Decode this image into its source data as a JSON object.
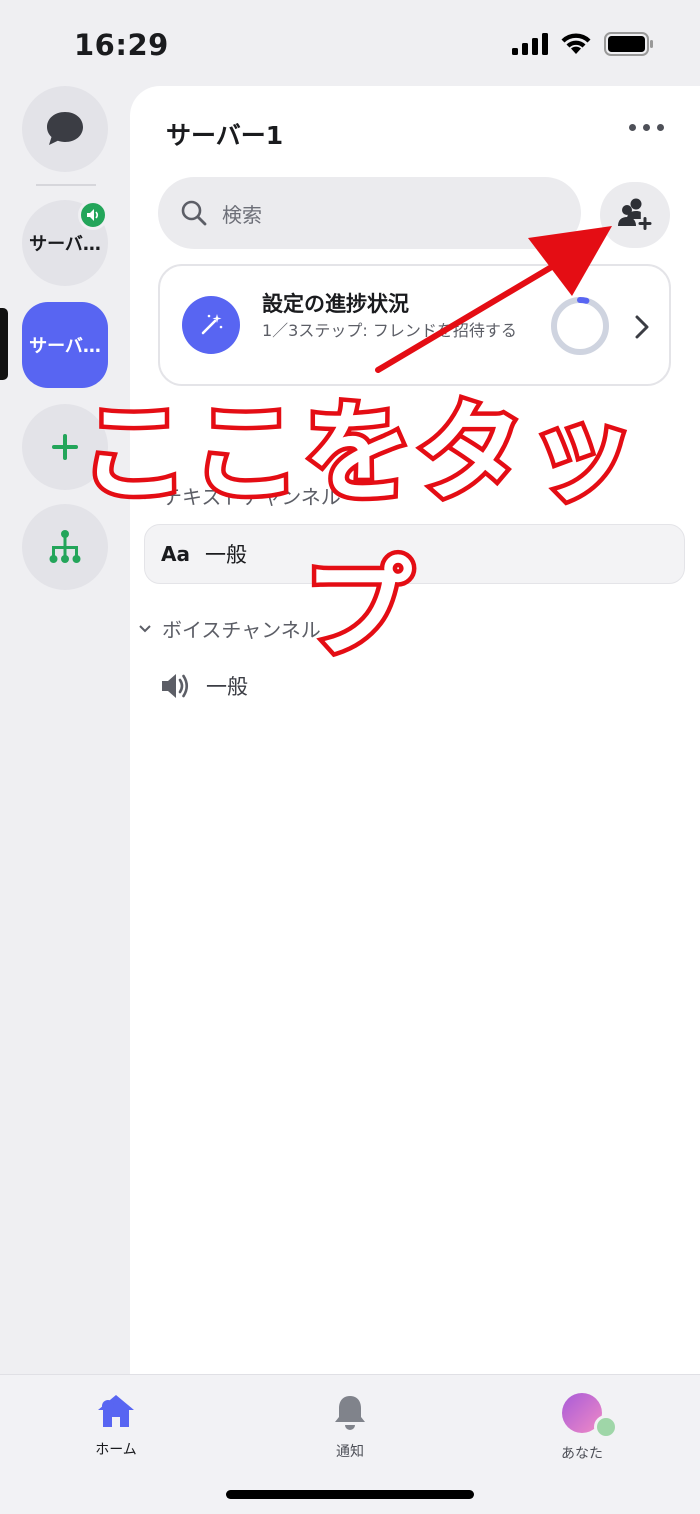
{
  "status_bar": {
    "time": "16:29",
    "icons": [
      "signal-icon",
      "wifi-icon",
      "battery-icon"
    ]
  },
  "rail": {
    "items": [
      {
        "icon": "chat-bubble-icon",
        "label": ""
      },
      {
        "label": "サーバ…",
        "badge_icon": "speaker-icon"
      },
      {
        "label": "サーバ…",
        "active": true
      },
      {
        "icon": "add-server-icon",
        "label": ""
      },
      {
        "icon": "hub-icon",
        "label": ""
      }
    ]
  },
  "header": {
    "server_name": "サーバー1",
    "more_icon": "ellipsis-icon"
  },
  "search": {
    "placeholder": "検索",
    "icon": "search-icon"
  },
  "invite": {
    "icon": "add-member-icon"
  },
  "setup_card": {
    "title": "設定の進捗状況",
    "subtitle": "1／3ステップ: フレンドを招待する",
    "progress_fraction": 0.33,
    "icon": "magic-wand-icon"
  },
  "categories": [
    {
      "name": "テキストチャンネル",
      "channels": [
        {
          "prefix": "Aa",
          "name": "一般",
          "selected": true
        }
      ]
    },
    {
      "name": "ボイスチャンネル",
      "channels": [
        {
          "icon": "speaker-icon",
          "name": "一般"
        }
      ]
    }
  ],
  "annotation": {
    "text": "ここをタップ",
    "color": "#e40d14"
  },
  "tabbar": {
    "tabs": [
      {
        "label": "ホーム",
        "icon": "home-icon",
        "active": true
      },
      {
        "label": "通知",
        "icon": "bell-icon"
      },
      {
        "label": "あなた",
        "icon": "avatar-icon"
      }
    ]
  },
  "colors": {
    "accent": "#5865f2",
    "online": "#23a55a",
    "arrow": "#e40d14"
  }
}
